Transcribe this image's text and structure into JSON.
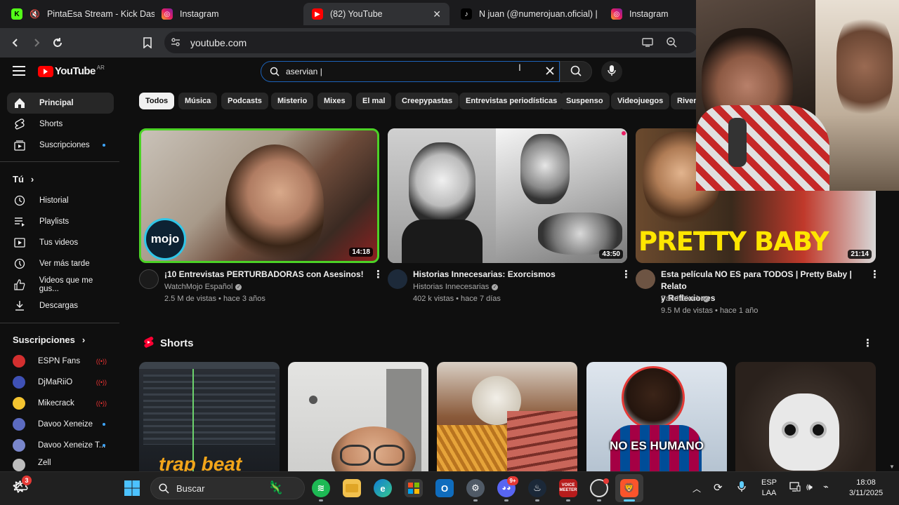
{
  "browser": {
    "tabs": [
      {
        "title": "PintaEsa Stream - Kick Dash",
        "favicon": "kick-logo",
        "muted": true,
        "active": false
      },
      {
        "title": "Instagram",
        "favicon": "instagram-logo",
        "active": false
      },
      {
        "title": "(82) YouTube",
        "favicon": "youtube-logo",
        "active": true
      },
      {
        "title": "N juan (@numerojuan.oficial) |",
        "favicon": "tiktok-logo",
        "active": false
      },
      {
        "title": "Instagram",
        "favicon": "instagram-logo",
        "active": false
      }
    ],
    "url": "youtube.com"
  },
  "youtube": {
    "logo_text": "YouTube",
    "region": "AR",
    "search": {
      "value": "aservian |"
    },
    "sidebar": {
      "main": [
        {
          "label": "Principal",
          "icon": "home-icon",
          "active": true
        },
        {
          "label": "Shorts",
          "icon": "shorts-icon"
        },
        {
          "label": "Suscripciones",
          "icon": "subscriptions-icon",
          "new": true
        }
      ],
      "you_label": "Tú",
      "you_items": [
        {
          "label": "Historial",
          "icon": "history-icon"
        },
        {
          "label": "Playlists",
          "icon": "playlists-icon"
        },
        {
          "label": "Tus videos",
          "icon": "your-videos-icon"
        },
        {
          "label": "Ver más tarde",
          "icon": "watch-later-icon"
        },
        {
          "label": "Videos que me gus...",
          "icon": "thumbs-up-icon"
        },
        {
          "label": "Descargas",
          "icon": "download-icon"
        }
      ],
      "subs_label": "Suscripciones",
      "subscriptions": [
        {
          "label": "ESPN Fans",
          "status": "live",
          "color": "#d32f2f"
        },
        {
          "label": "DjMaRiiO",
          "status": "live",
          "color": "#3f51b5"
        },
        {
          "label": "Mikecrack",
          "status": "live",
          "color": "#f4c430"
        },
        {
          "label": "Davoo Xeneize",
          "status": "new",
          "color": "#5c6bc0"
        },
        {
          "label": "Davoo Xeneize T...",
          "status": "new",
          "color": "#7986cb"
        },
        {
          "label": "Zell",
          "status": "",
          "color": "#bdbdbd"
        }
      ]
    },
    "chips": [
      "Todos",
      "Música",
      "Podcasts",
      "Misterio",
      "Mixes",
      "El mal",
      "Creepypastas",
      "Entrevistas periodísticas",
      "Suspenso",
      "Videojuegos",
      "River"
    ],
    "videos": [
      {
        "title": "¡10 Entrevistas PERTURBADORAS con Asesinos!",
        "title2": "",
        "channel": "WatchMojo Español",
        "meta": "2.5 M de vistas • hace 3 años",
        "duration": "14:18",
        "thumb_text": "mojo"
      },
      {
        "title": "Historias Innecesarias: Exorcismos",
        "title2": "",
        "channel": "Historias Innecesarias",
        "meta": "402 k vistas • hace 7 días",
        "duration": "43:50",
        "thumb_text": ""
      },
      {
        "title": "Esta película NO ES para TODOS | Pretty Baby | Relato",
        "title2": "y Reflexiones",
        "channel": "Farid Dieck",
        "meta": "9.5 M de vistas • hace 1 año",
        "duration": "21:14",
        "thumb_text": "PRETTY BABY"
      }
    ],
    "shorts_label": "Shorts",
    "shorts": [
      {
        "overlay": "trap beat"
      },
      {
        "overlay": ""
      },
      {
        "overlay": ""
      },
      {
        "overlay": "NO ES HUMANO"
      },
      {
        "overlay": ""
      }
    ]
  },
  "taskbar": {
    "search_placeholder": "Buscar",
    "widget_badge": "3",
    "discord_badge": "9+",
    "voicemeeter_label": "VOICE MEETER",
    "lang_top": "ESP",
    "lang_bottom": "LAA",
    "time": "18:08",
    "date": "3/11/2025"
  }
}
